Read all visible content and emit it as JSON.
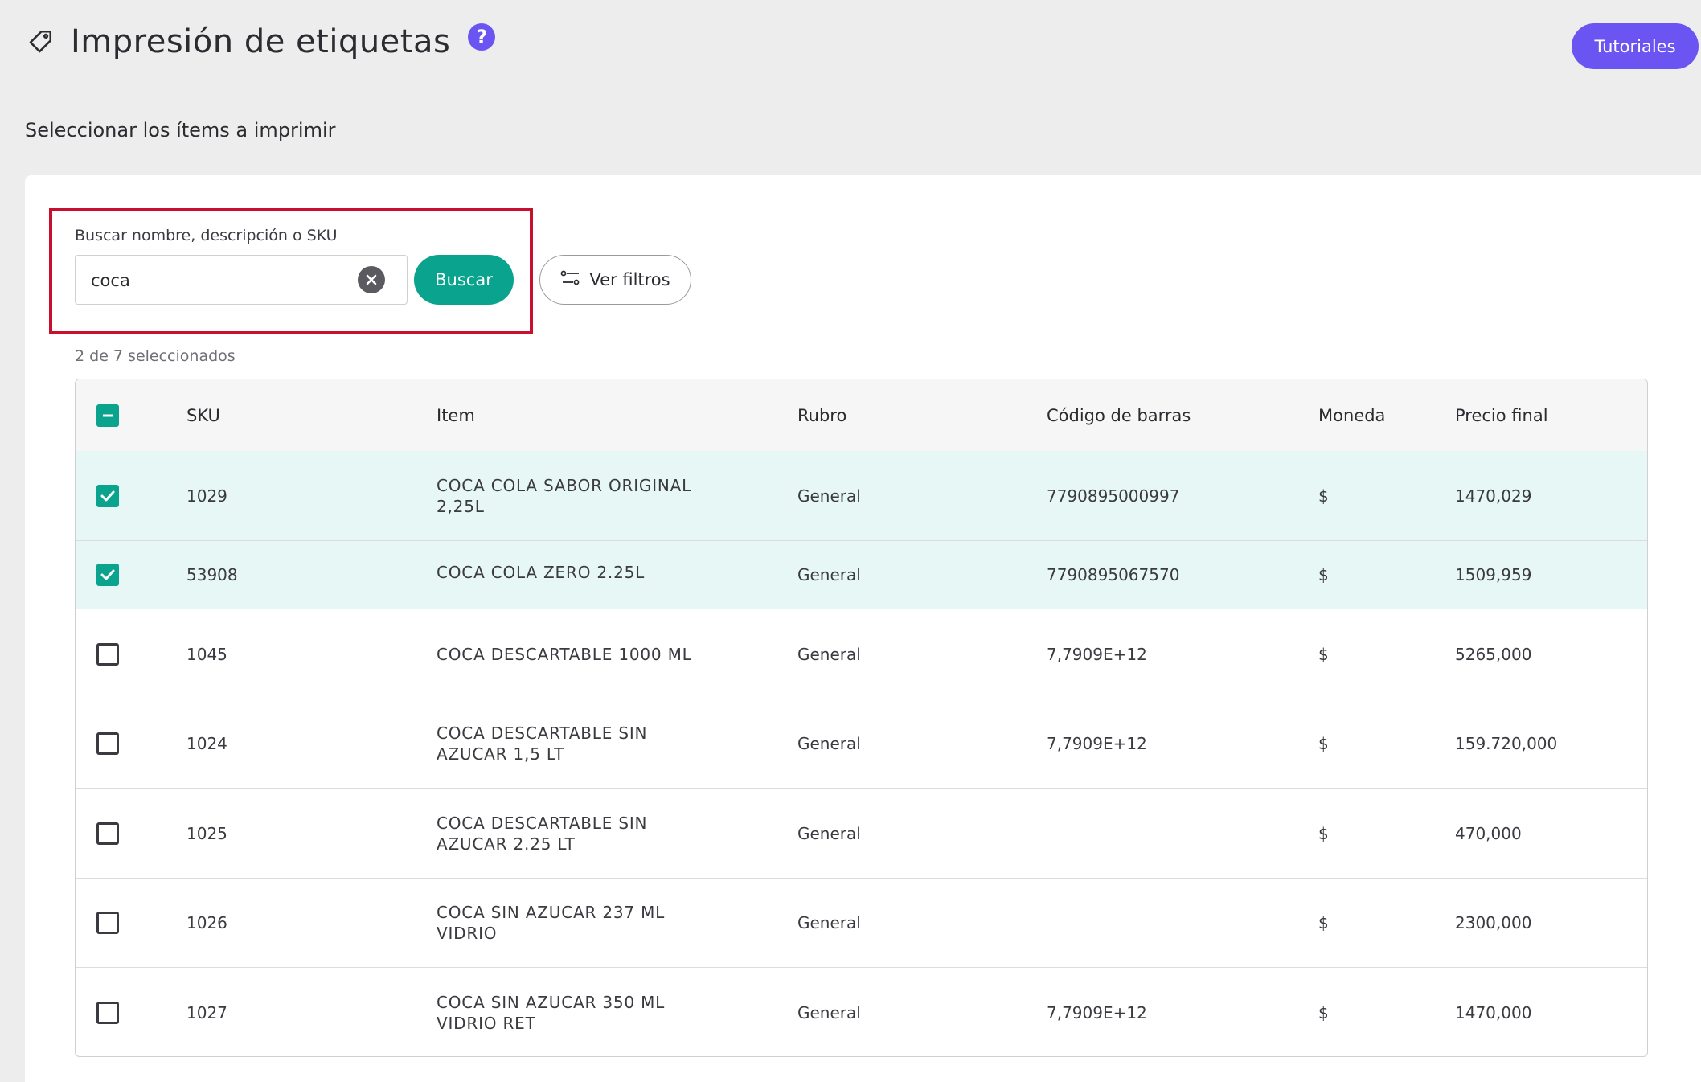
{
  "header": {
    "title": "Impresión de etiquetas",
    "help_label": "?",
    "tutorials_label": "Tutoriales"
  },
  "section_title": "Seleccionar los ítems a imprimir",
  "search": {
    "label": "Buscar nombre, descripción o SKU",
    "value": "coca",
    "button_label": "Buscar",
    "filters_label": "Ver filtros"
  },
  "selection_count": "2 de 7 seleccionados",
  "colors": {
    "accent": "#0aa38d",
    "brand": "#6b55f2",
    "highlight_border": "#c8102e",
    "selected_row": "#e6f7f5"
  },
  "table": {
    "columns": [
      "SKU",
      "Item",
      "Rubro",
      "Código de barras",
      "Moneda",
      "Precio final"
    ],
    "rows": [
      {
        "selected": true,
        "sku": "1029",
        "item": "COCA COLA SABOR ORIGINAL 2,25L",
        "rubro": "General",
        "barcode": "7790895000997",
        "moneda": "$",
        "precio": "1470,029"
      },
      {
        "selected": true,
        "sku": "53908",
        "item": "COCA COLA ZERO 2.25L",
        "rubro": "General",
        "barcode": "7790895067570",
        "moneda": "$",
        "precio": "1509,959"
      },
      {
        "selected": false,
        "sku": "1045",
        "item": "COCA DESCARTABLE 1000 ML",
        "rubro": "General",
        "barcode": "7,7909E+12",
        "moneda": "$",
        "precio": "5265,000"
      },
      {
        "selected": false,
        "sku": "1024",
        "item": "COCA DESCARTABLE SIN AZUCAR 1,5 LT",
        "rubro": "General",
        "barcode": "7,7909E+12",
        "moneda": "$",
        "precio": "159.720,000"
      },
      {
        "selected": false,
        "sku": "1025",
        "item": "COCA DESCARTABLE SIN AZUCAR 2.25 LT",
        "rubro": "General",
        "barcode": "",
        "moneda": "$",
        "precio": "470,000"
      },
      {
        "selected": false,
        "sku": "1026",
        "item": "COCA SIN AZUCAR 237 ML VIDRIO",
        "rubro": "General",
        "barcode": "",
        "moneda": "$",
        "precio": "2300,000"
      },
      {
        "selected": false,
        "sku": "1027",
        "item": "COCA SIN AZUCAR 350 ML VIDRIO RET",
        "rubro": "General",
        "barcode": "7,7909E+12",
        "moneda": "$",
        "precio": "1470,000"
      }
    ]
  }
}
